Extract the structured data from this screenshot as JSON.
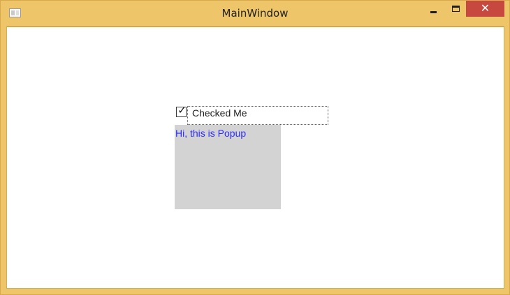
{
  "window": {
    "title": "MainWindow",
    "controls": {
      "minimize_icon": "minimize-icon",
      "maximize_icon": "maximize-icon",
      "close_label": "✕"
    },
    "colors": {
      "frame": "#efc56a",
      "close_button": "#c7483f",
      "client_background": "#ffffff"
    }
  },
  "content": {
    "checkbox": {
      "label": "Checked Me",
      "checked": true,
      "check_glyph": "✓"
    },
    "popup": {
      "text": "Hi, this is Popup",
      "background": "#d3d3d3",
      "text_color": "#2b2bff"
    }
  }
}
